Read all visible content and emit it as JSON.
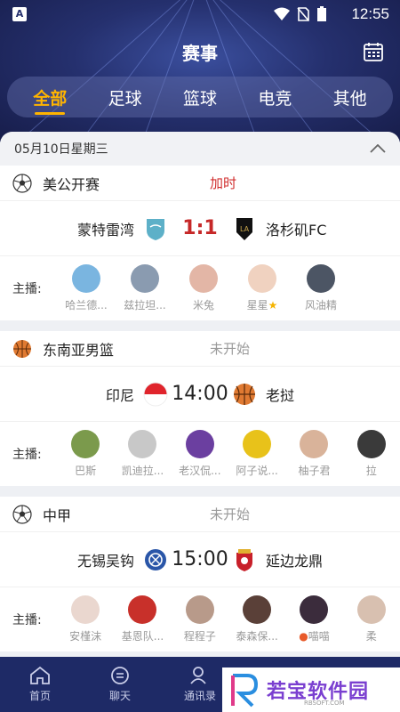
{
  "status": {
    "badge": "A",
    "time": "12:55"
  },
  "header": {
    "title": "赛事"
  },
  "tabs": [
    {
      "label": "全部",
      "active": true
    },
    {
      "label": "足球",
      "active": false
    },
    {
      "label": "篮球",
      "active": false
    },
    {
      "label": "电竞",
      "active": false
    },
    {
      "label": "其他",
      "active": false
    }
  ],
  "date_label": "05月10日星期三",
  "anchor_label": "主播:",
  "matches": [
    {
      "sport_icon": "soccer-ball-icon",
      "league": "美公开赛",
      "state": "加时",
      "live": true,
      "home": "蒙特雷湾",
      "away": "洛杉矶FC",
      "score": "1:1",
      "anchors": [
        "哈兰德...",
        "兹拉坦...",
        "米兔",
        "星星",
        "风油精"
      ]
    },
    {
      "sport_icon": "basketball-icon",
      "league": "东南亚男篮",
      "state": "未开始",
      "live": false,
      "home": "印尼",
      "away": "老挝",
      "score": "14:00",
      "anchors": [
        "巴斯",
        "凯迪拉...",
        "老汉侃...",
        "阿子说...",
        "柚子君",
        "拉"
      ]
    },
    {
      "sport_icon": "soccer-ball-icon",
      "league": "中甲",
      "state": "未开始",
      "live": false,
      "home": "无锡吴钩",
      "away": "延边龙鼎",
      "score": "15:00",
      "anchors": [
        "安槿沫",
        "基恩队...",
        "程程子",
        "泰森保...",
        "喵喵",
        "柔"
      ]
    }
  ],
  "nav": [
    {
      "label": "首页",
      "icon": "home-icon"
    },
    {
      "label": "聊天",
      "icon": "chat-icon"
    },
    {
      "label": "通讯录",
      "icon": "contacts-icon"
    }
  ],
  "watermark": {
    "text": "若宝软件园",
    "sub": "RBSOFT.COM"
  },
  "colors": {
    "accent": "#ffb400",
    "live": "#c62828",
    "header": "#25306e",
    "nav": "#1e2a66"
  }
}
